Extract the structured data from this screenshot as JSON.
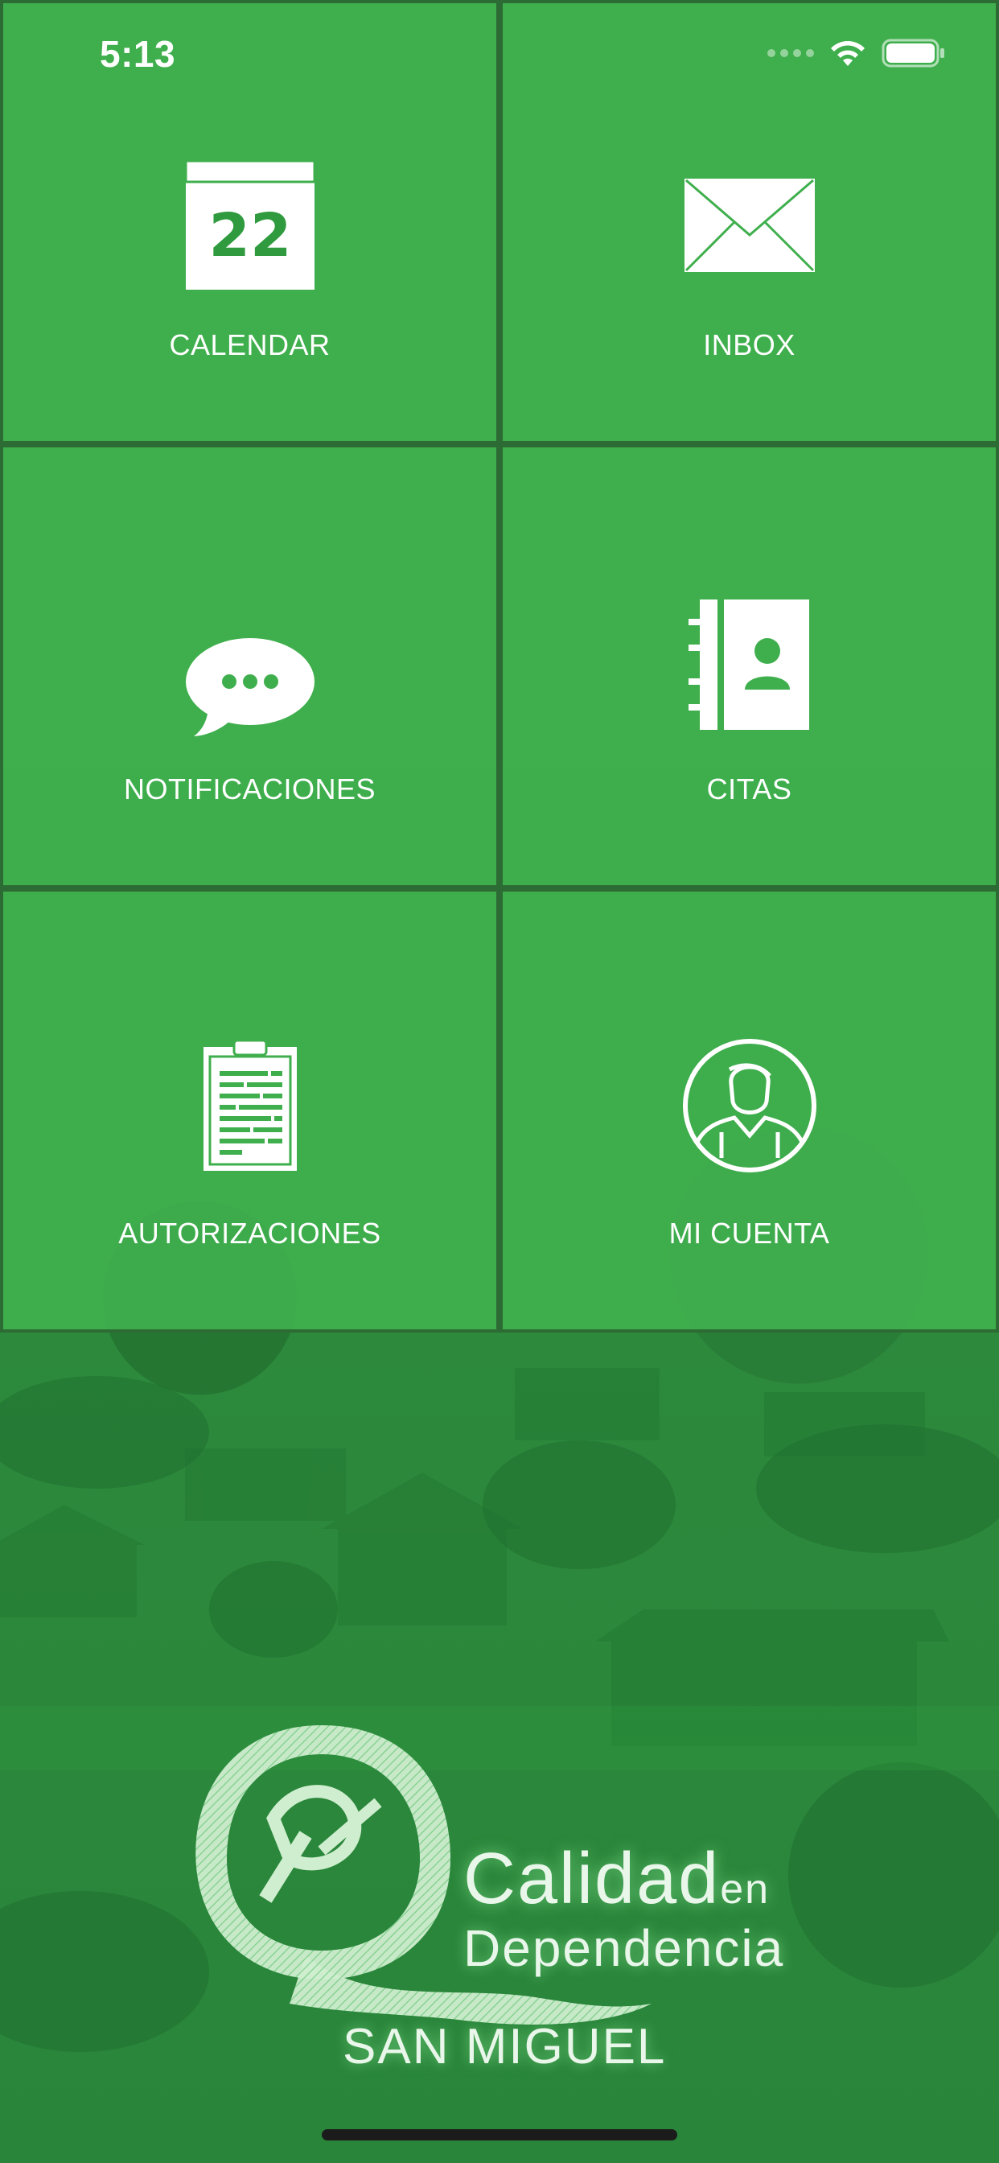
{
  "status_bar": {
    "time": "5:13",
    "icons": [
      "signal-dots-icon",
      "wifi-icon",
      "battery-icon"
    ]
  },
  "tiles": [
    {
      "label": "CALENDAR",
      "icon": "calendar-icon",
      "icon_text": "22"
    },
    {
      "label": "INBOX",
      "icon": "envelope-icon"
    },
    {
      "label": "NOTIFICACIONES",
      "icon": "chat-bubble-icon"
    },
    {
      "label": "CITAS",
      "icon": "contacts-book-icon"
    },
    {
      "label": "AUTORIZACIONES",
      "icon": "clipboard-icon"
    },
    {
      "label": "MI CUENTA",
      "icon": "user-circle-icon"
    }
  ],
  "logo": {
    "title": "Calidad",
    "title_suffix": "en",
    "subtitle": "Dependencia",
    "place": "SAN MIGUEL"
  },
  "colors": {
    "tile": "#3faf4d",
    "tile_border": "#2d6b34",
    "text": "#ffffff"
  }
}
